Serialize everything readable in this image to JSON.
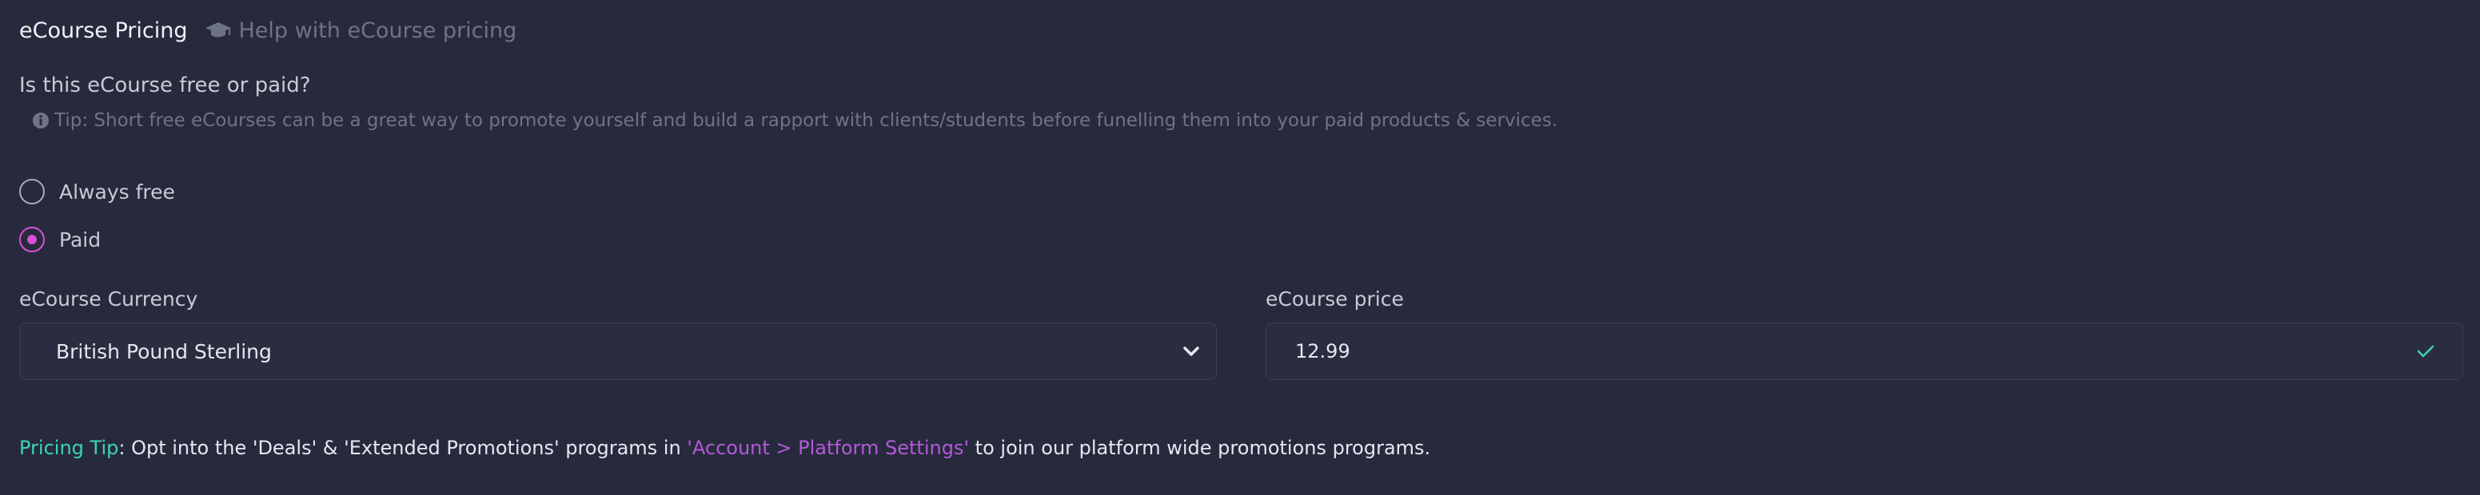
{
  "header": {
    "title": "eCourse Pricing",
    "help_text": "Help with eCourse pricing",
    "help_icon": "graduation-cap-icon"
  },
  "question": "Is this eCourse free or paid?",
  "tip": {
    "icon": "info-circle-icon",
    "text": "Tip: Short free eCourses can be a great way to promote yourself and build a rapport with clients/students before funelling them into your paid products & services."
  },
  "pricing_options": [
    {
      "label": "Always free",
      "selected": false
    },
    {
      "label": "Paid",
      "selected": true
    }
  ],
  "currency": {
    "label": "eCourse Currency",
    "value": "British Pound Sterling",
    "icon": "chevron-down-icon"
  },
  "price": {
    "label": "eCourse price",
    "value": "12.99",
    "icon": "check-icon"
  },
  "pricing_tip": {
    "label": "Pricing Tip",
    "before": ": Opt into the 'Deals' & 'Extended Promotions' programs in ",
    "link": "'Account > Platform Settings'",
    "after": " to join our platform wide promotions programs."
  },
  "colors": {
    "background": "#272a3d",
    "accent_pink": "#d94fd6",
    "accent_green": "#3fd3b2",
    "link_purple": "#b25ad7"
  }
}
